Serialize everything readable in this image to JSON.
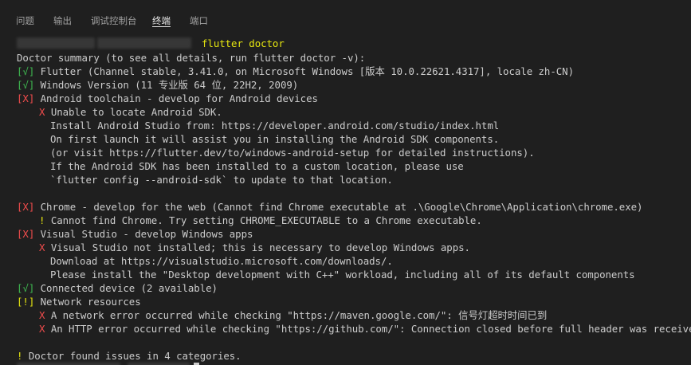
{
  "tabs": [
    {
      "label": "问题"
    },
    {
      "label": "输出"
    },
    {
      "label": "调试控制台"
    },
    {
      "label": "终端"
    },
    {
      "label": "端口"
    }
  ],
  "terminal": {
    "command": "flutter doctor",
    "summary": "Doctor summary (to see all details, run flutter doctor -v):",
    "lines": {
      "flutter_mark": "[√]",
      "flutter": " Flutter (Channel stable, 3.41.0, on Microsoft Windows [版本 10.0.22621.4317], locale zh-CN)",
      "winver_mark": "[√]",
      "winver": " Windows Version (11 专业版 64 位, 22H2, 2009)",
      "android_mark": "[X]",
      "android": " Android toolchain - develop for Android devices",
      "android_x": "X",
      "android_1": " Unable to locate Android SDK.",
      "android_2": "Install Android Studio from: https://developer.android.com/studio/index.html",
      "android_3": "On first launch it will assist you in installing the Android SDK components.",
      "android_4": "(or visit https://flutter.dev/to/windows-android-setup for detailed instructions).",
      "android_5": "If the Android SDK has been installed to a custom location, please use",
      "android_6": "`flutter config --android-sdk` to update to that location.",
      "chrome_mark": "[X]",
      "chrome": " Chrome - develop for the web (Cannot find Chrome executable at .\\Google\\Chrome\\Application\\chrome.exe)",
      "chrome_warn": "!",
      "chrome_1": " Cannot find Chrome. Try setting CHROME_EXECUTABLE to a Chrome executable.",
      "vs_mark": "[X]",
      "vs": " Visual Studio - develop Windows apps",
      "vs_x": "X",
      "vs_1": " Visual Studio not installed; this is necessary to develop Windows apps.",
      "vs_2": "Download at https://visualstudio.microsoft.com/downloads/.",
      "vs_3": "Please install the \"Desktop development with C++\" workload, including all of its default components",
      "device_mark": "[√]",
      "device": " Connected device (2 available)",
      "network_mark": "[!]",
      "network": " Network resources",
      "network_x1": "X",
      "network_1": " A network error occurred while checking \"https://maven.google.com/\": 信号灯超时时间已到",
      "network_x2": "X",
      "network_2": " An HTTP error occurred while checking \"https://github.com/\": Connection closed before full header was received",
      "found_warn": "!",
      "found": " Doctor found issues in 4 categories."
    }
  },
  "colors": {
    "background": "#1f1f1f",
    "text": "#cccccc",
    "ok": "#3fb950",
    "error": "#f14c4c",
    "warn": "#e5e510"
  }
}
